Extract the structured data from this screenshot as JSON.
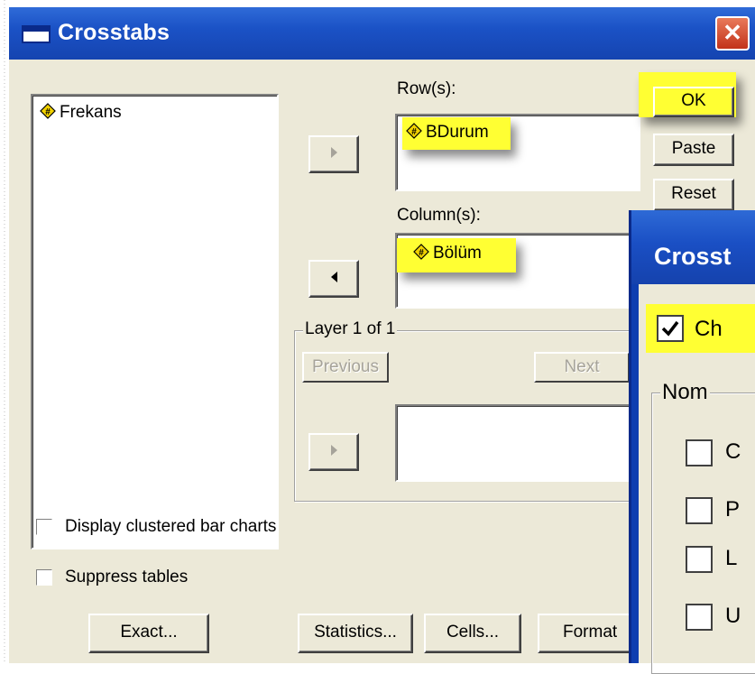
{
  "window": {
    "title": "Crosstabs",
    "close_label": "✕"
  },
  "variables": {
    "items": [
      "Frekans"
    ]
  },
  "rows": {
    "label": "Row(s):",
    "items": [
      "BDurum"
    ]
  },
  "columns": {
    "label": "Column(s):",
    "items": [
      "Bölüm"
    ]
  },
  "layer": {
    "label": "Layer 1 of 1",
    "previous": "Previous",
    "next": "Next"
  },
  "buttons": {
    "ok": "OK",
    "paste": "Paste",
    "reset": "Reset",
    "exact": "Exact...",
    "statistics": "Statistics...",
    "cells": "Cells...",
    "format": "Format"
  },
  "options": {
    "clustered": "Display clustered bar charts",
    "suppress": "Suppress tables"
  },
  "sub_dialog": {
    "title": "Crosst",
    "chi_label": "Ch",
    "chi_checked": true,
    "group_label": "Nom",
    "items": [
      "C",
      "P",
      "L",
      "U"
    ]
  },
  "colors": {
    "highlight": "#ffff33",
    "title_bar": "#1b52c6",
    "face": "#ece9d8"
  }
}
